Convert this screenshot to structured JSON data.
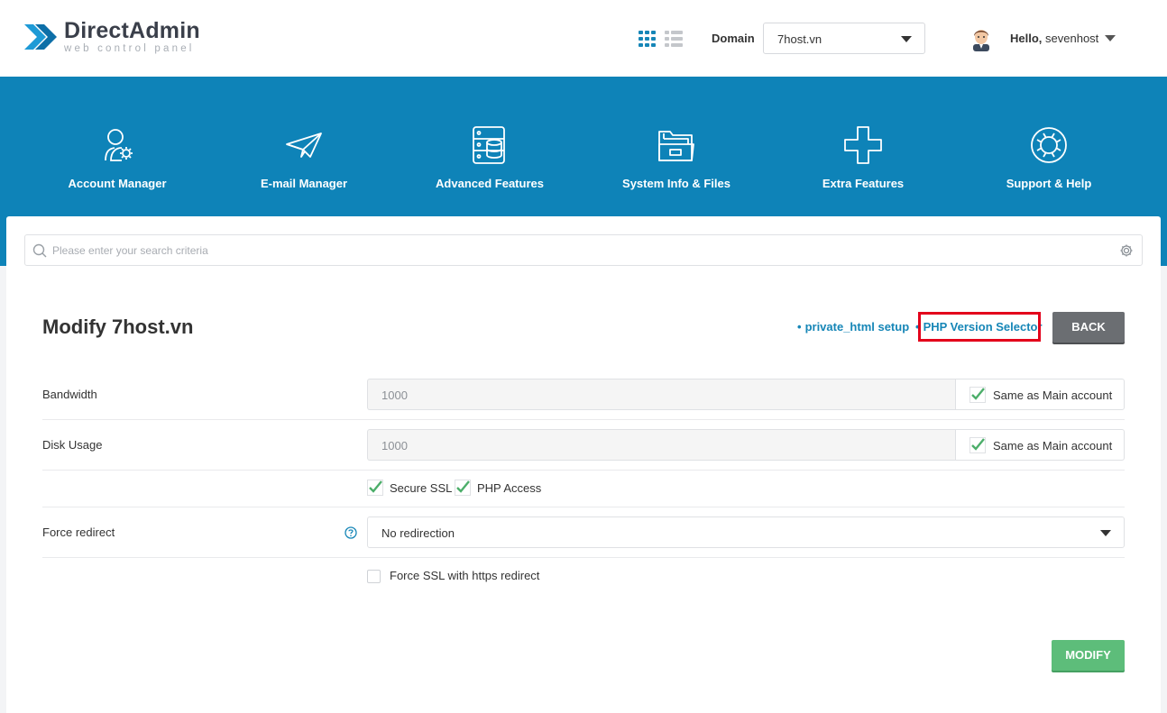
{
  "brand": {
    "title": "DirectAdmin",
    "subtitle": "web control panel"
  },
  "header": {
    "domain_label": "Domain",
    "domain_value": "7host.vn",
    "hello_prefix": "Hello,",
    "username": "sevenhost"
  },
  "nav": {
    "items": [
      {
        "label": "Account Manager",
        "icon": "account-manager-icon"
      },
      {
        "label": "E-mail Manager",
        "icon": "paper-plane-icon"
      },
      {
        "label": "Advanced Features",
        "icon": "server-database-icon"
      },
      {
        "label": "System Info & Files",
        "icon": "folder-icon"
      },
      {
        "label": "Extra Features",
        "icon": "plus-icon"
      },
      {
        "label": "Support & Help",
        "icon": "lifebuoy-icon"
      }
    ]
  },
  "search": {
    "placeholder": "Please enter your search criteria"
  },
  "page": {
    "title": "Modify 7host.vn",
    "links": {
      "private_html": "private_html setup",
      "php_selector": "PHP Version Selector"
    },
    "back_label": "BACK"
  },
  "form": {
    "bandwidth": {
      "label": "Bandwidth",
      "value": "1000",
      "same_label": "Same as Main account",
      "same_checked": true
    },
    "disk": {
      "label": "Disk Usage",
      "value": "1000",
      "same_label": "Same as Main account",
      "same_checked": true
    },
    "options": {
      "secure_ssl": "Secure SSL",
      "php_access": "PHP Access"
    },
    "force_redirect": {
      "label": "Force redirect",
      "value": "No redirection"
    },
    "force_ssl": {
      "label": "Force SSL with https redirect",
      "checked": false
    },
    "submit_label": "MODIFY"
  },
  "colors": {
    "nav_bg": "#0e83b8",
    "link": "#1686b7",
    "highlight": "#e3001b",
    "back_button": "#6b6e72",
    "modify_button": "#5dbd7a",
    "check": "#4cae6a"
  }
}
